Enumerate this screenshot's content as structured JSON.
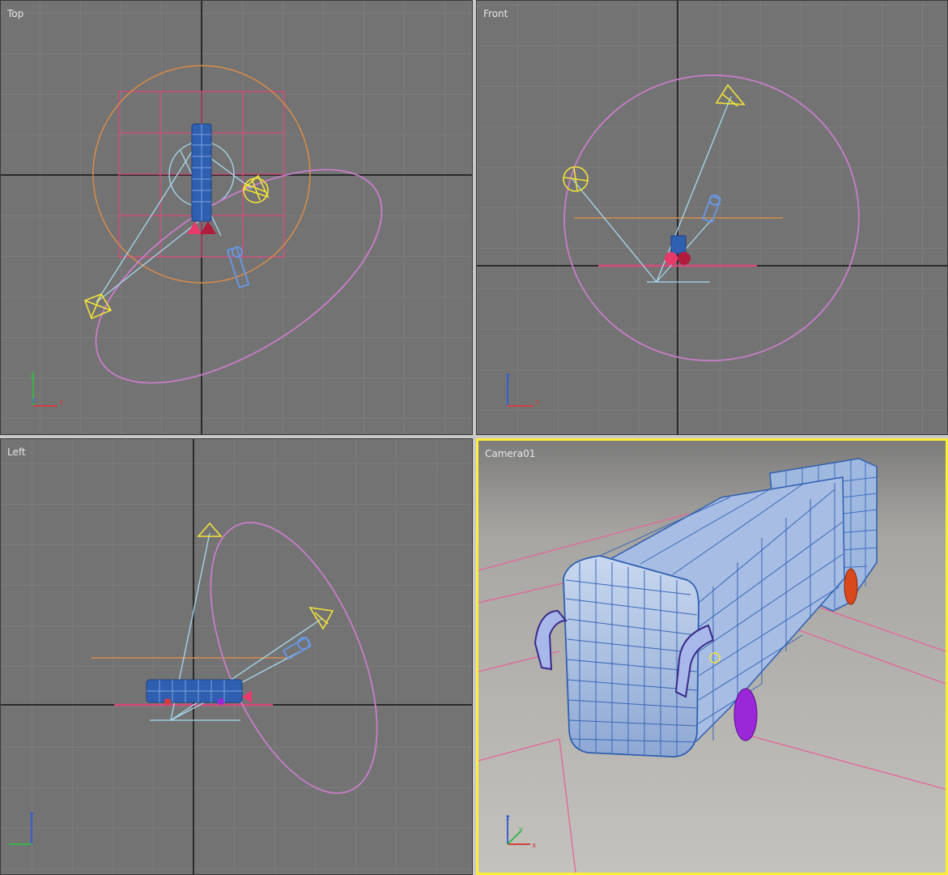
{
  "viewports": {
    "top": {
      "label": "Top"
    },
    "front": {
      "label": "Front"
    },
    "left": {
      "label": "Left"
    },
    "camera": {
      "label": "Camera01"
    }
  },
  "axes": {
    "x": "x",
    "y": "y",
    "z": "z"
  },
  "colors": {
    "grid_bg": "#737373",
    "grid_line": "#8a8a8a",
    "home_grid_axis": "#2a2a2a",
    "active_border": "#ffef3a",
    "light_cone": "#f1e23a",
    "light_line": "#a8d8ee",
    "path_ellipse": "#c77ec9",
    "range_circle": "#d98c4a",
    "grid_object": "#d8487a",
    "bus_wire": "#2f5fb0",
    "bus_surface": "#a9c0e4",
    "wheel": "#9a28d8"
  }
}
